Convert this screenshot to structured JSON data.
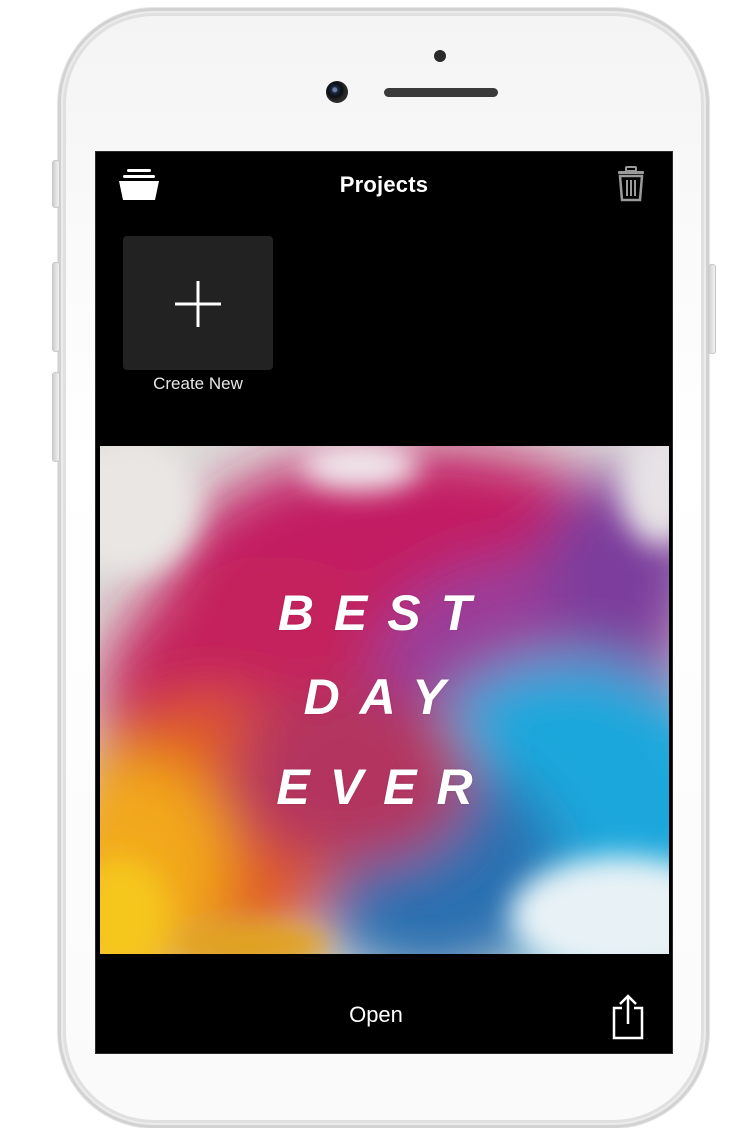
{
  "navbar": {
    "title": "Projects",
    "left_icon": "folder-stack-icon",
    "right_icon": "trash-icon"
  },
  "create_new": {
    "label": "Create New",
    "icon": "plus-icon"
  },
  "project": {
    "title_lines": [
      "BEST",
      "DAY",
      "EVER"
    ]
  },
  "bottom_bar": {
    "open_label": "Open",
    "share_icon": "share-icon"
  },
  "colors": {
    "background": "#000000",
    "tile": "#222222",
    "text": "#ffffff",
    "icon_gray": "#9a9a9a"
  }
}
